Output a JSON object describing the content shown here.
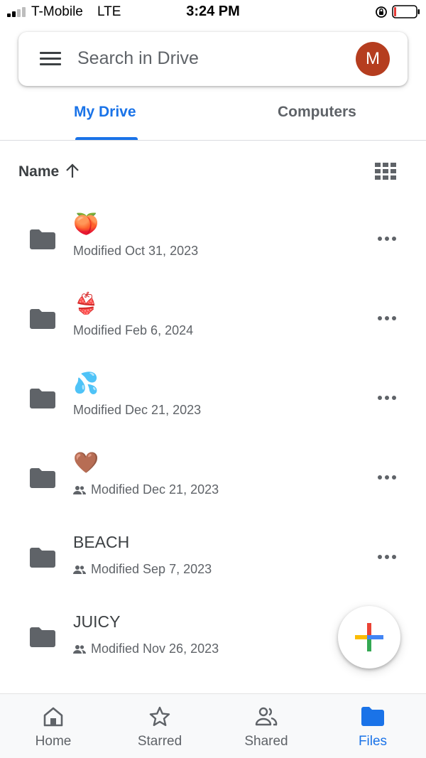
{
  "status_bar": {
    "carrier": "T-Mobile",
    "network": "LTE",
    "time": "3:24 PM",
    "icons": [
      "signal-icon",
      "rotation-lock-icon",
      "battery-icon"
    ]
  },
  "search": {
    "placeholder": "Search in Drive",
    "avatar_letter": "M",
    "avatar_color": "#b53d1f"
  },
  "tabs": [
    {
      "label": "My Drive",
      "active": true
    },
    {
      "label": "Computers",
      "active": false
    }
  ],
  "sort": {
    "label": "Name",
    "direction": "ascending",
    "view_icon": "grid-view-icon"
  },
  "files": [
    {
      "name": "🍑",
      "modified": "Modified Oct 31, 2023",
      "shared": false,
      "type": "folder"
    },
    {
      "name": "👙",
      "modified": "Modified Feb 6, 2024",
      "shared": false,
      "type": "folder"
    },
    {
      "name": "💦",
      "modified": "Modified Dec 21, 2023",
      "shared": false,
      "type": "folder"
    },
    {
      "name": "🤎",
      "modified": "Modified Dec 21, 2023",
      "shared": true,
      "type": "folder"
    },
    {
      "name": "BEACH",
      "modified": "Modified Sep 7, 2023",
      "shared": true,
      "type": "folder"
    },
    {
      "name": "JUICY",
      "modified": "Modified Nov 26, 2023",
      "shared": true,
      "type": "folder"
    }
  ],
  "fab": {
    "icon": "plus-icon"
  },
  "bottom_nav": [
    {
      "label": "Home",
      "icon": "home-icon",
      "active": false
    },
    {
      "label": "Starred",
      "icon": "star-icon",
      "active": false
    },
    {
      "label": "Shared",
      "icon": "shared-icon",
      "active": false
    },
    {
      "label": "Files",
      "icon": "folder-icon",
      "active": true
    }
  ],
  "colors": {
    "accent": "#1a73e8",
    "text": "#3c4043",
    "secondary_text": "#5f6368",
    "folder": "#5f6368"
  }
}
